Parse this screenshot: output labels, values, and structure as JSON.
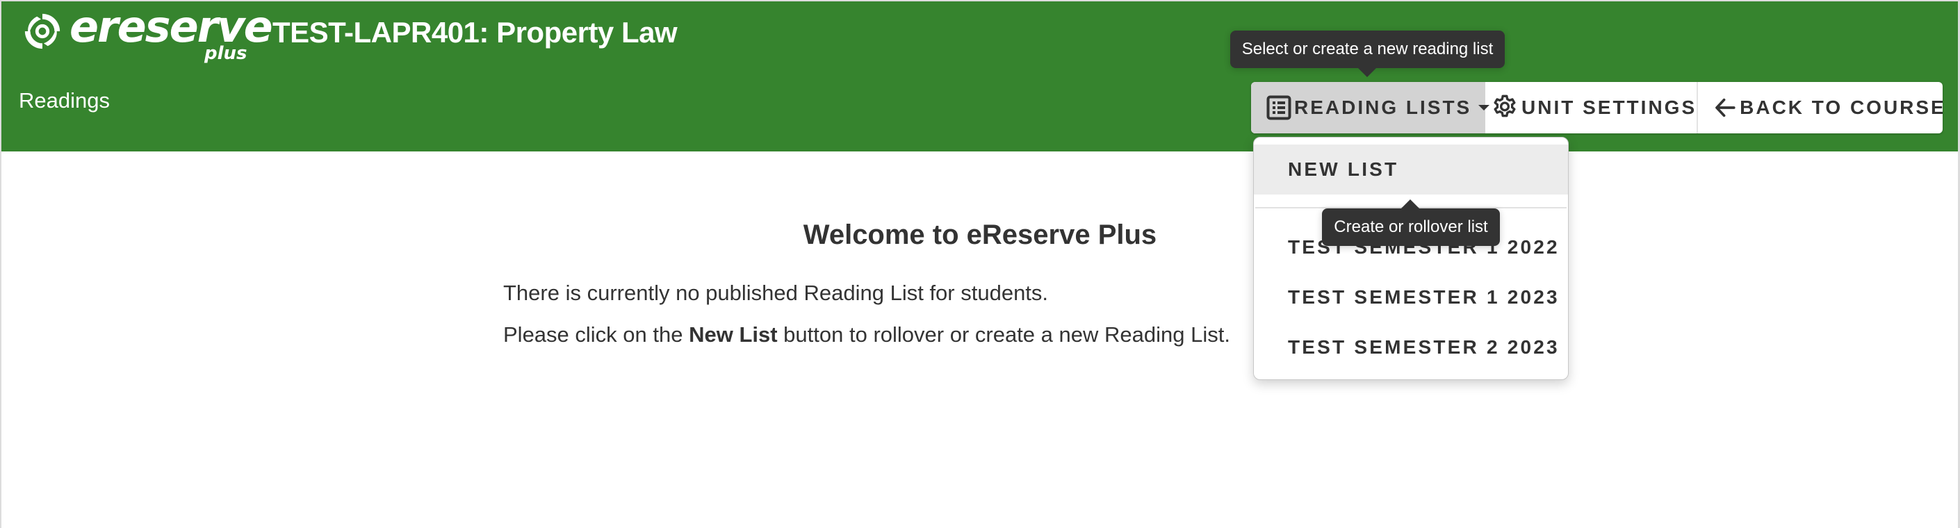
{
  "header": {
    "logo_text": "ereserve",
    "logo_sub": "plus",
    "course_title": "TEST-LAPR401: Property Law",
    "subnav_label": "Readings",
    "brand_color": "#36842e"
  },
  "toolbar": {
    "reading_lists": {
      "label": "READING LISTS",
      "icon": "list-alt-icon",
      "tooltip": "Select or create a new reading list"
    },
    "unit_settings": {
      "label": "UNIT SETTINGS",
      "icon": "gear-icon"
    },
    "back_to_course": {
      "label": "BACK TO COURSE",
      "icon": "arrow-left-icon"
    }
  },
  "dropdown": {
    "new_list": {
      "label": "NEW LIST",
      "tooltip": "Create or rollover list"
    },
    "lists": [
      {
        "label": "TEST SEMESTER 1 2022"
      },
      {
        "label": "TEST SEMESTER 1 2023"
      },
      {
        "label": "TEST SEMESTER 2 2023"
      }
    ]
  },
  "main": {
    "heading": "Welcome to eReserve Plus",
    "line1": "There is currently no published Reading List for students.",
    "line2_pre": "Please click on the ",
    "line2_bold": "New List",
    "line2_post": " button to rollover or create a new Reading List."
  }
}
